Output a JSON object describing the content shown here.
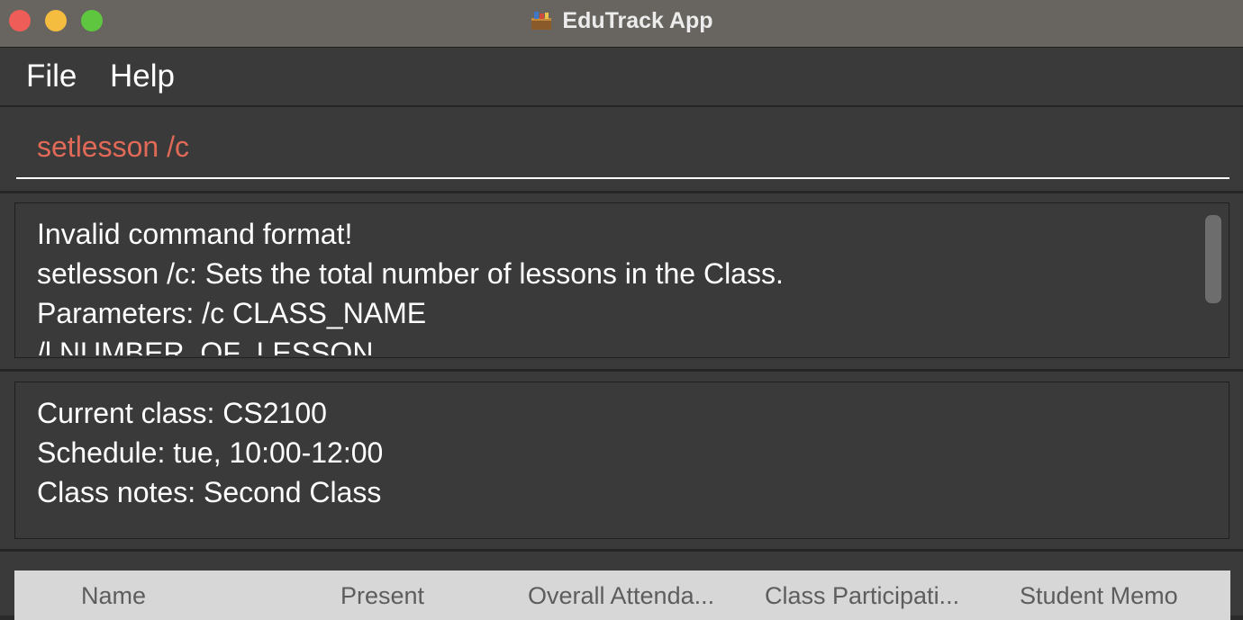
{
  "window": {
    "title": "EduTrack App",
    "app_icon": "books-icon"
  },
  "menu": {
    "items": [
      {
        "label": "File"
      },
      {
        "label": "Help"
      }
    ]
  },
  "command": {
    "value": "setlesson /c",
    "text_color": "#e06a57"
  },
  "result": {
    "lines": [
      "Invalid command format!",
      "setlesson /c: Sets the total number of lessons in the Class.",
      "Parameters: /c CLASS_NAME",
      "/l NUMBER_OF_LESSON"
    ]
  },
  "class_info": {
    "lines": [
      "Current class: CS2100",
      "Schedule: tue, 10:00-12:00",
      "Class notes: Second Class"
    ]
  },
  "table": {
    "columns": [
      "Name",
      "Present",
      "Overall Attenda...",
      "Class Participati...",
      "Student Memo"
    ]
  }
}
